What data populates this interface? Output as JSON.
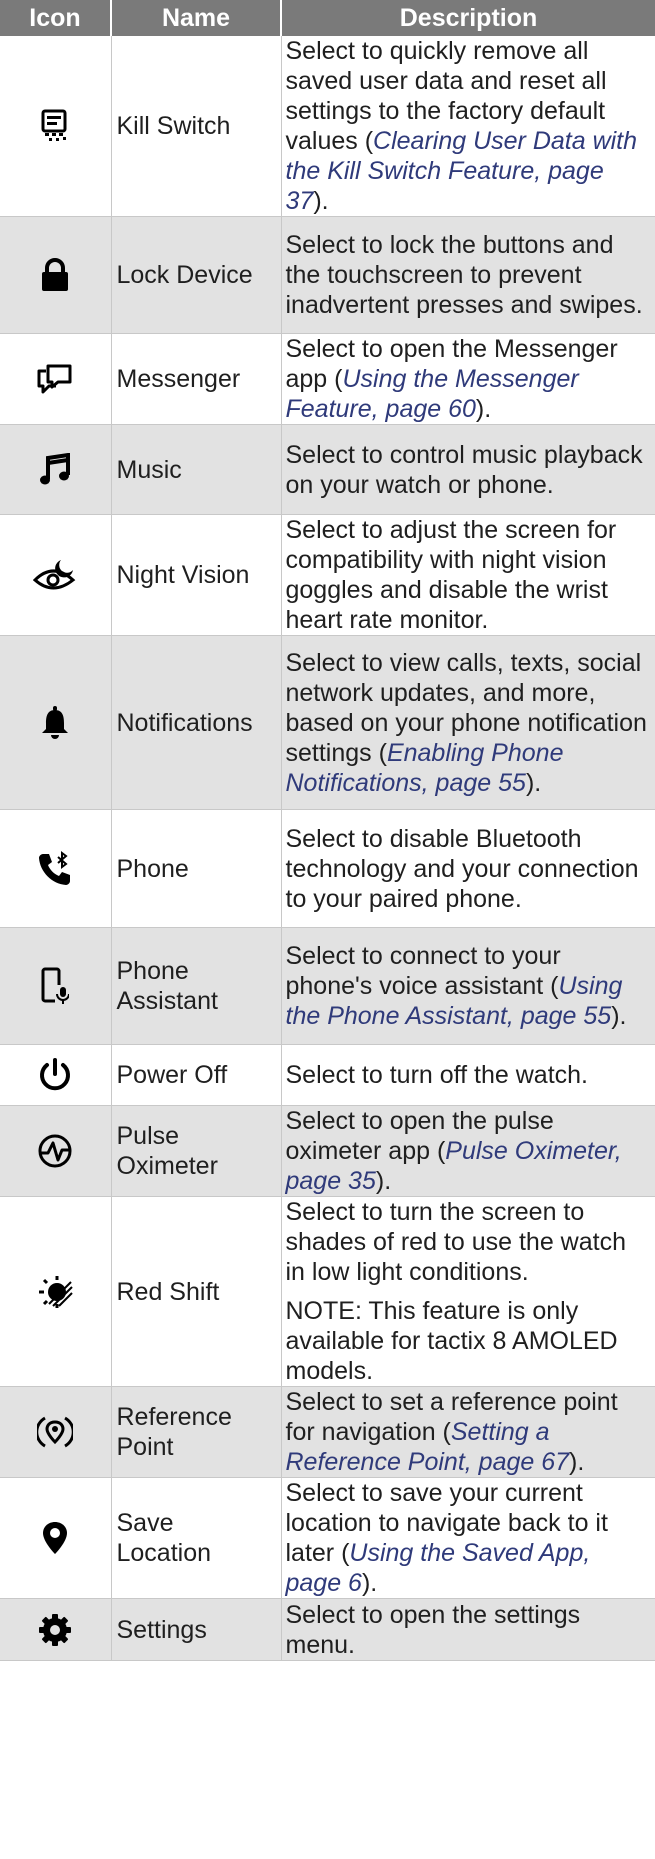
{
  "headers": {
    "icon": "Icon",
    "name": "Name",
    "description": "Description"
  },
  "rows": [
    {
      "icon": "kill-switch-icon",
      "name": "Kill Switch",
      "desc": "Select to quickly remove all saved user data and reset all settings to the factory default values (",
      "ref": "Clearing User Data with the Kill Switch Feature, page 37",
      "desc_after": ")."
    },
    {
      "icon": "lock-icon",
      "name": "Lock Device",
      "desc": "Select to lock the buttons and the touchscreen to prevent inadvertent presses and swipes."
    },
    {
      "icon": "messenger-icon",
      "name": "Messenger",
      "desc": "Select to open the Messenger app (",
      "ref": "Using the Messenger Feature, page 60",
      "desc_after": ")."
    },
    {
      "icon": "music-note-icon",
      "name": "Music",
      "desc": "Select to control music playback on your watch or phone."
    },
    {
      "icon": "night-vision-icon",
      "name": "Night Vision",
      "desc": "Select to adjust the screen for compatibility with night vision goggles and disable the wrist heart rate monitor."
    },
    {
      "icon": "bell-icon",
      "name": "Notifications",
      "desc": "Select to view calls, texts, social network updates, and more, based on your phone notification settings (",
      "ref": "Enabling Phone Notifications, page 55",
      "desc_after": ")."
    },
    {
      "icon": "phone-bluetooth-icon",
      "name": "Phone",
      "desc": "Select to disable Bluetooth technology and your connection to your paired phone."
    },
    {
      "icon": "phone-microphone-icon",
      "name": "Phone Assistant",
      "desc": "Select to connect to your phone's voice assistant (",
      "ref": "Using the Phone Assistant, page 55",
      "desc_after": ")."
    },
    {
      "icon": "power-icon",
      "name": "Power Off",
      "desc": "Select to turn off the watch."
    },
    {
      "icon": "pulse-oximeter-icon",
      "name": "Pulse Oximeter",
      "desc": "Select to open the pulse oximeter app (",
      "ref": "Pulse Oximeter, page 35",
      "desc_after": ")."
    },
    {
      "icon": "red-shift-icon",
      "name": "Red Shift",
      "desc": "Select to turn the screen to shades of red to use the watch in low light conditions.",
      "note": "NOTE: This feature is only available for tactix 8 AMOLED models."
    },
    {
      "icon": "reference-point-icon",
      "name": "Reference Point",
      "desc": "Select to set a reference point for navigation (",
      "ref": "Setting a Reference Point, page 67",
      "desc_after": ")."
    },
    {
      "icon": "location-pin-icon",
      "name": "Save Location",
      "desc": "Select to save your current location to navigate back to it later (",
      "ref": "Using the Saved App, page 6",
      "desc_after": ")."
    },
    {
      "icon": "gear-icon",
      "name": "Settings",
      "desc": "Select to open the settings menu."
    }
  ]
}
